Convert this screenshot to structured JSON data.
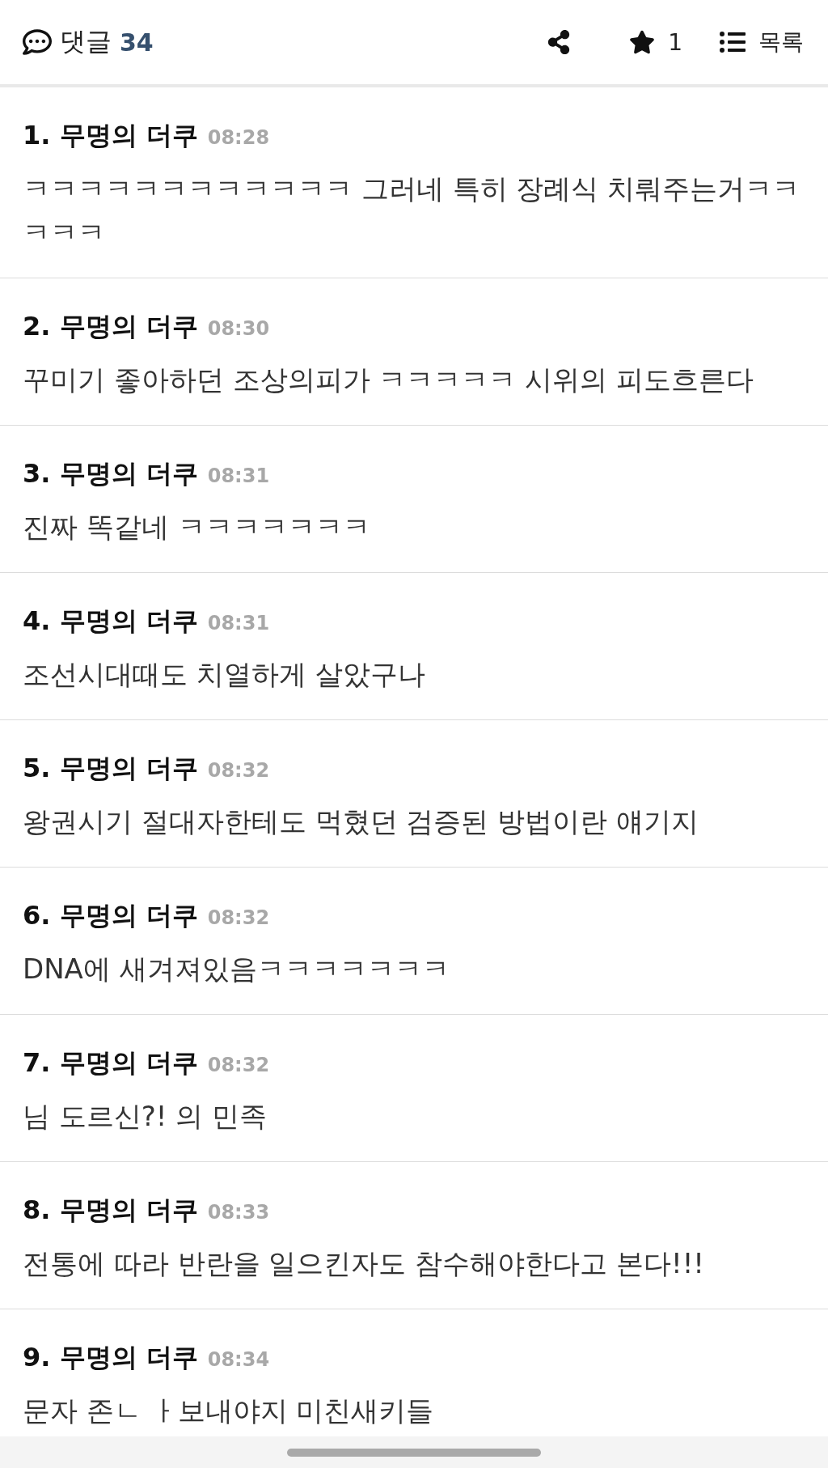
{
  "header": {
    "comments_label": "댓글",
    "comment_count": "34",
    "star_count": "1",
    "list_label": "목록"
  },
  "comments": [
    {
      "title": "1. 무명의 더쿠",
      "time": "08:28",
      "body": "ㅋㅋㅋㅋㅋㅋㅋㅋㅋㅋㅋㅋ 그러네 특히 장례식 치뤄주는거ㅋㅋㅋㅋㅋ"
    },
    {
      "title": "2. 무명의 더쿠",
      "time": "08:30",
      "body": "꾸미기 좋아하던 조상의피가 ㅋㅋㅋㅋㅋ 시위의 피도흐른다"
    },
    {
      "title": "3. 무명의 더쿠",
      "time": "08:31",
      "body": "진짜 똑같네 ㅋㅋㅋㅋㅋㅋㅋ"
    },
    {
      "title": "4. 무명의 더쿠",
      "time": "08:31",
      "body": "조선시대때도 치열하게 살았구나"
    },
    {
      "title": "5. 무명의 더쿠",
      "time": "08:32",
      "body": "왕권시기 절대자한테도 먹혔던 검증된 방법이란 얘기지"
    },
    {
      "title": "6. 무명의 더쿠",
      "time": "08:32",
      "body": "DNA에 새겨져있음ㅋㅋㅋㅋㅋㅋㅋ"
    },
    {
      "title": "7. 무명의 더쿠",
      "time": "08:32",
      "body": "님 도르신?! 의 민족"
    },
    {
      "title": "8. 무명의 더쿠",
      "time": "08:33",
      "body": "전통에 따라 반란을 일으킨자도 참수해야한다고 본다!!!"
    },
    {
      "title": "9. 무명의 더쿠",
      "time": "08:34",
      "body": "문자 존ㄴ ㅏ보내야지 미친새키들"
    }
  ]
}
